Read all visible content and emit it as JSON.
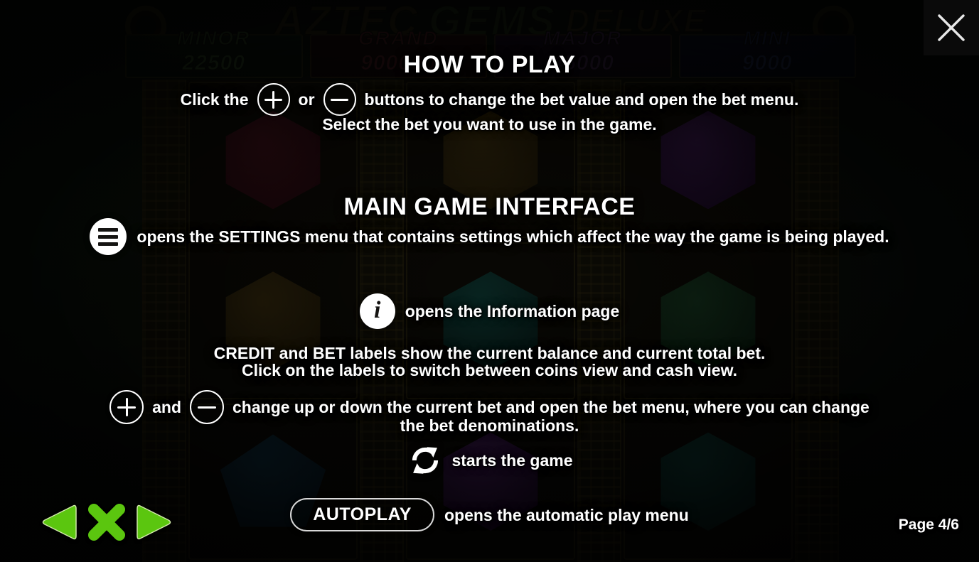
{
  "window": {
    "close_icon": "close-icon"
  },
  "background_game": {
    "logo": {
      "word1": "AZTEC",
      "word2": "GEMS",
      "word3": "DELUXE"
    },
    "jackpots": [
      {
        "name": "MINOR",
        "value": "22500"
      },
      {
        "name": "GRAND",
        "value": "900000"
      },
      {
        "name": "MAJOR",
        "value": "45000"
      },
      {
        "name": "MINI",
        "value": "9000"
      }
    ]
  },
  "help": {
    "title_how_to_play": "HOW TO PLAY",
    "bet_line_prefix": "Click the",
    "bet_line_or": "or",
    "bet_line_suffix": "buttons to change the bet value and open the bet menu.",
    "bet_line_2": "Select the bet you want to use in the game.",
    "title_main_interface": "MAIN GAME INTERFACE",
    "settings_text": "opens the SETTINGS menu that contains settings which affect the way the game is being played.",
    "info_text": "opens the Information page",
    "credit_text_1": "CREDIT and BET labels show the current balance and current total bet.",
    "credit_text_2": "Click on the labels to switch between coins view and cash view.",
    "betchange_prefix": "and",
    "betchange_text_1": "change up or down the current bet and open the bet menu, where you can change",
    "betchange_text_2": "the bet denominations.",
    "spin_text": "starts the game",
    "autoplay_label": "AUTOPLAY",
    "autoplay_text": "opens the automatic play menu",
    "icons": {
      "plus": "plus-icon",
      "minus": "minus-icon",
      "settings": "hamburger-menu-icon",
      "info": "info-icon",
      "spin": "spin-refresh-icon"
    }
  },
  "footer": {
    "page_indicator": "Page 4/6",
    "prev_icon": "previous-page-icon",
    "close_icon": "close-help-icon",
    "next_icon": "next-page-icon"
  },
  "colors": {
    "accent_green": "#5BC60F",
    "text": "#FFFFFF",
    "backdrop": "#070B08"
  }
}
